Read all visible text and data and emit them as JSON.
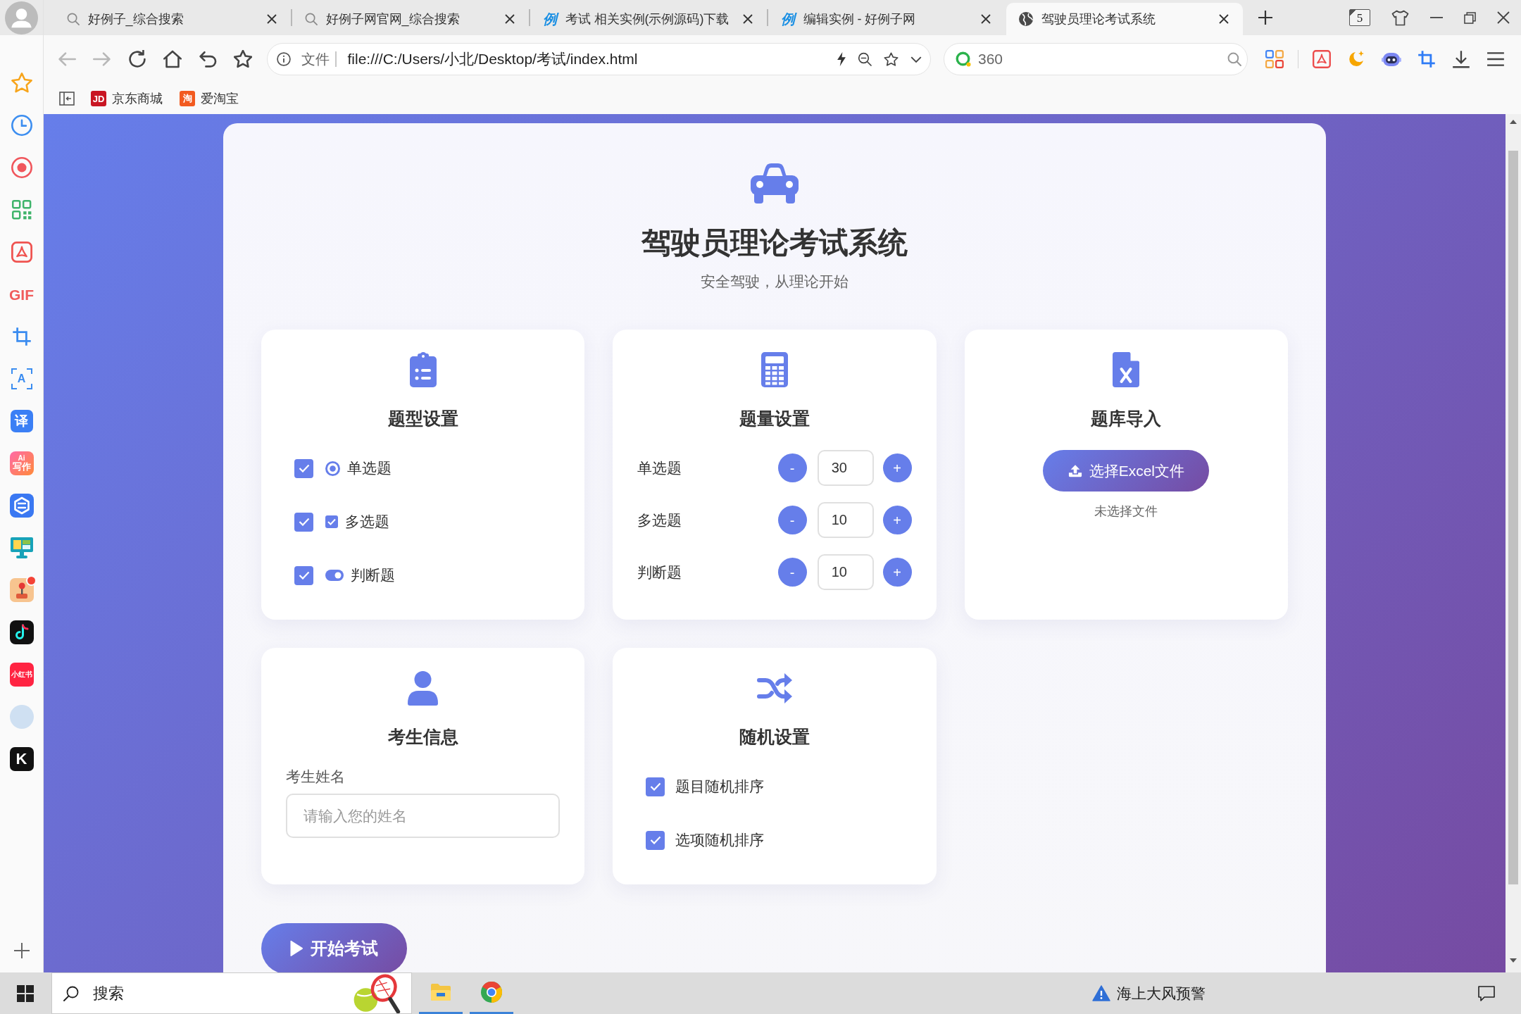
{
  "browser": {
    "tabs": [
      {
        "kind": "search",
        "title": "好例子_综合搜索",
        "selected": false
      },
      {
        "kind": "search",
        "title": "好例子网官网_综合搜索",
        "selected": false
      },
      {
        "kind": "site",
        "icon_text": "例",
        "title": "考试 相关实例(示例源码)下载",
        "selected": false
      },
      {
        "kind": "site",
        "icon_text": "例",
        "title": "编辑实例 - 好例子网",
        "selected": false
      },
      {
        "kind": "globe",
        "title": "驾驶员理论考试系统",
        "selected": true
      }
    ],
    "tab_count": "5",
    "nav_buttons": [
      {
        "kind": "back",
        "disabled": true
      },
      {
        "kind": "forward",
        "disabled": true
      },
      {
        "kind": "reload",
        "disabled": false
      },
      {
        "kind": "home",
        "disabled": false
      },
      {
        "kind": "undo",
        "disabled": false
      },
      {
        "kind": "favorite",
        "disabled": false
      }
    ],
    "address_bar": {
      "scheme": "文件",
      "url": "file:///C:/Users/小北/Desktop/考试/index.html"
    },
    "search_box": {
      "placeholder": "360"
    },
    "bookmarks": [
      {
        "logo_text": "JD",
        "label": "京东商城",
        "color": "#c91623"
      },
      {
        "logo_text": "淘",
        "label": "爱淘宝",
        "color": "#f25a1f"
      }
    ]
  },
  "sidebar": [
    {
      "kind": "star"
    },
    {
      "kind": "clock"
    },
    {
      "kind": "record"
    },
    {
      "kind": "grid"
    },
    {
      "kind": "pdf"
    },
    {
      "kind": "gif",
      "label": "GIF"
    },
    {
      "kind": "crop"
    },
    {
      "kind": "ocr",
      "label": "A"
    },
    {
      "kind": "translate",
      "label": "译"
    },
    {
      "kind": "ai",
      "badge": "Ai",
      "label": "写作"
    },
    {
      "kind": "hexagon"
    },
    {
      "kind": "monitor"
    },
    {
      "kind": "game",
      "notification": true
    },
    {
      "kind": "music"
    },
    {
      "kind": "notes",
      "label": "小红书"
    },
    {
      "kind": "avatar"
    },
    {
      "kind": "k",
      "label": "K"
    },
    {
      "kind": "add"
    }
  ],
  "page": {
    "title": "驾驶员理论考试系统",
    "subtitle": "安全驾驶，从理论开始",
    "cards": [
      {
        "kind": "question_types",
        "title": "题型设置",
        "options": [
          {
            "kind": "radio",
            "label": "单选题",
            "checked": true
          },
          {
            "kind": "checkbox",
            "label": "多选题",
            "checked": true
          },
          {
            "kind": "toggle",
            "label": "判断题",
            "checked": true
          }
        ]
      },
      {
        "kind": "question_counts",
        "title": "题量设置",
        "rows": [
          {
            "label": "单选题",
            "minus": "-",
            "value": "30",
            "plus": "+"
          },
          {
            "label": "多选题",
            "minus": "-",
            "value": "10",
            "plus": "+"
          },
          {
            "label": "判断题",
            "minus": "-",
            "value": "10",
            "plus": "+"
          }
        ]
      },
      {
        "kind": "import",
        "title": "题库导入",
        "button": "选择Excel文件",
        "status": "未选择文件"
      },
      {
        "kind": "student",
        "title": "考生信息",
        "field_label": "考生姓名",
        "placeholder": "请输入您的姓名"
      },
      {
        "kind": "random",
        "title": "随机设置",
        "options": [
          {
            "label": "题目随机排序",
            "checked": true
          },
          {
            "label": "选项随机排序",
            "checked": true
          }
        ]
      }
    ],
    "start_button": "开始考试"
  },
  "taskbar": {
    "search": {
      "placeholder": "搜索"
    },
    "apps": [
      {
        "kind": "folder",
        "running": true
      },
      {
        "kind": "browser",
        "running": true
      }
    ],
    "alert": "海上大风预警"
  }
}
